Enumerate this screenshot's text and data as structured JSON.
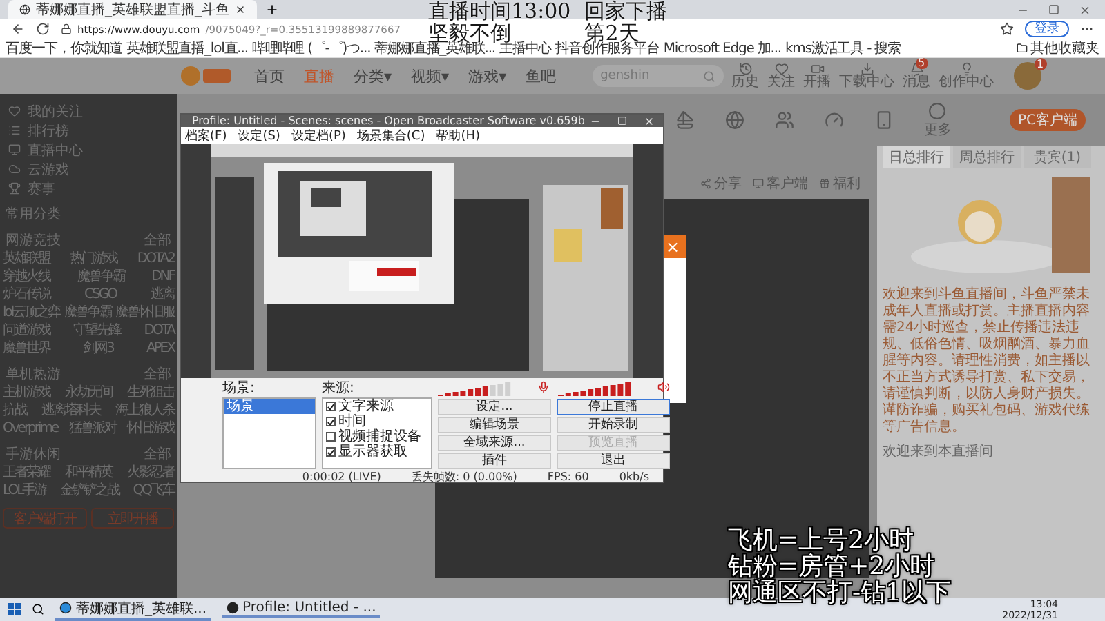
{
  "overlay": {
    "top": [
      [
        "直播时间13:00",
        "回家下播"
      ],
      [
        "坚毅不倒",
        "第2天"
      ]
    ],
    "bottom": [
      "飞机=上号2小时",
      "钻粉=房管+2小时",
      "网通区不打-钻1以下"
    ]
  },
  "browser": {
    "tab_title": "蒂娜娜直播_英雄联盟直播_斗鱼",
    "url_host": "https://www.douyu.com",
    "url_rest": "/9075049?_r=0.35513199889877667",
    "login": "登录",
    "other_bookmarks": "其他收藏夹",
    "bookmarks": [
      "百度一下，你就知道",
      "英雄联盟直播_lol直...",
      "哔哩哔哩 (゜-゜)つ...",
      "蒂娜娜直播_英雄联...",
      "主播中心",
      "抖音创作服务平台",
      "Microsoft Edge 加...",
      "kms激活工具 - 搜索"
    ]
  },
  "site": {
    "nav": [
      {
        "label": "首页",
        "selected": false
      },
      {
        "label": "直播",
        "selected": true
      },
      {
        "label": "分类▾",
        "selected": false
      },
      {
        "label": "视频▾",
        "selected": false
      },
      {
        "label": "游戏▾",
        "selected": false
      },
      {
        "label": "鱼吧",
        "selected": false
      }
    ],
    "search": {
      "placeholder": "genshin"
    },
    "actions": [
      {
        "label": "历史"
      },
      {
        "label": "关注"
      },
      {
        "label": "开播"
      },
      {
        "label": "下载中心"
      },
      {
        "label": "消息",
        "badge": "5"
      },
      {
        "label": "创作中心"
      }
    ],
    "avatar_badge": "1",
    "more": "更多",
    "pc_client": "PC客户端",
    "room_links": [
      "分享",
      "客户端",
      "福利"
    ],
    "sidebar": {
      "top": [
        "我的关注",
        "排行榜",
        "直播中心",
        "云游戏",
        "赛事"
      ],
      "common": "常用分类",
      "sections": [
        {
          "title": "网游竞技",
          "all": "全部",
          "items": [
            "英雄联盟",
            "热门游戏",
            "DOTA2",
            "穿越火线",
            "魔兽争霸",
            "DNF",
            "炉石传说",
            "CSGO",
            "逃离",
            "lol云顶之弈",
            "魔兽争霸",
            "魔兽怀旧服",
            "问道游戏",
            "守望先锋",
            "DOTA",
            "魔兽世界",
            "剑网3",
            "APEX"
          ]
        },
        {
          "title": "单机热游",
          "all": "全部",
          "items": [
            "主机游戏",
            "永劫无间",
            "生死狙击",
            "抗战",
            "逃离塔科夫",
            "海上狼人杀",
            "Overprime",
            "猛兽派对",
            "怀旧游戏"
          ]
        },
        {
          "title": "手游休闲",
          "all": "全部",
          "items": [
            "王者荣耀",
            "和平精英",
            "火影忍者",
            "LOL手游",
            "金铲铲之战",
            "QQ飞车"
          ]
        }
      ],
      "buttons": [
        "客户端打开",
        "立即开播"
      ]
    },
    "panel": {
      "tabs": [
        {
          "label": "日总排行",
          "selected": true
        },
        {
          "label": "周总排行",
          "selected": false
        },
        {
          "label": "贵宾(1)",
          "selected": false
        }
      ],
      "notice": "欢迎来到斗鱼直播间，斗鱼严禁未成年人直播或打赏。主播直播内容需24小时巡查，禁止传播违法违规、低俗色情、吸烟酗酒、暴力血腥等内容。请理性消费，如主播以不正当方式诱导打赏、私下交易，请谨慎判断，以防人身财产损失。谨防诈骗，购买礼包码、游戏代练等广告信息。",
      "welcome": "欢迎来到本直播间"
    }
  },
  "obs": {
    "title": "Profile: Untitled - Scenes: scenes - Open Broadcaster Software v0.659b",
    "menu": [
      "档案(F)",
      "设定(S)",
      "设定档(P)",
      "场景集合(C)",
      "帮助(H)"
    ],
    "scenes_label": "场景:",
    "scenes": [
      {
        "label": "场景",
        "selected": true
      }
    ],
    "sources_label": "来源:",
    "sources": [
      {
        "label": "文字来源",
        "checked": true
      },
      {
        "label": "时间",
        "checked": true
      },
      {
        "label": "视频捕捉设备",
        "checked": false
      },
      {
        "label": "显示器获取",
        "checked": true
      }
    ],
    "meters": [
      {
        "kind": "mic",
        "level": 0.65
      },
      {
        "kind": "desktop",
        "level": 1
      }
    ],
    "buttons": [
      {
        "label": "设定...",
        "disabled": false,
        "focused": false
      },
      {
        "label": "停止直播",
        "disabled": false,
        "focused": true
      },
      {
        "label": "编辑场景",
        "disabled": false,
        "focused": false
      },
      {
        "label": "开始录制",
        "disabled": false,
        "focused": false
      },
      {
        "label": "全域来源...",
        "disabled": false,
        "focused": false
      },
      {
        "label": "预览直播",
        "disabled": true,
        "focused": false
      },
      {
        "label": "插件",
        "disabled": false,
        "focused": false
      },
      {
        "label": "退出",
        "disabled": false,
        "focused": false
      }
    ],
    "status": [
      "0:00:02 (LIVE)",
      "丢失帧数: 0 (0.00%)",
      "FPS: 60",
      "0kb/s"
    ]
  },
  "dialog": {
    "close": "×"
  },
  "taskbar": {
    "apps": [
      "蒂娜娜直播_英雄联...",
      "Profile: Untitled - ..."
    ],
    "time": "13:04",
    "date": "2022/12/31"
  }
}
